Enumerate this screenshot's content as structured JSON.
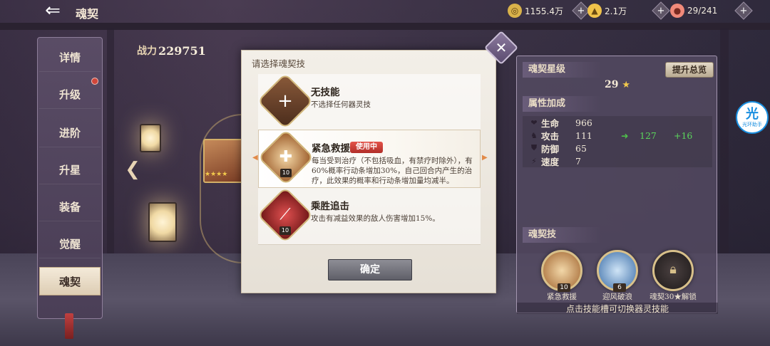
{
  "header": {
    "page_title": "魂契",
    "resources": [
      {
        "icon": "coin-icon",
        "value": "1155.4万",
        "color": "#d9b24a"
      },
      {
        "icon": "gold-ingot-icon",
        "value": "2.1万",
        "color": "#f0c24a"
      },
      {
        "icon": "peach-icon",
        "value": "29/241",
        "color": "#f08a7a"
      }
    ]
  },
  "nav": {
    "items": [
      {
        "label": "详情"
      },
      {
        "label": "升级"
      },
      {
        "label": "进阶"
      },
      {
        "label": "升星"
      },
      {
        "label": "装备"
      },
      {
        "label": "觉醒"
      },
      {
        "label": "魂契"
      }
    ],
    "active_index": 6
  },
  "hero": {
    "power_label": "战力",
    "power_value": "229751"
  },
  "right_panel": {
    "star_section_title": "魂契星级",
    "star_upgrade_button": "提升总览",
    "star_total": "29",
    "star_symbol": "★",
    "attr_section_title": "属性加成",
    "attrs": [
      {
        "icon": "heart-icon",
        "name": "生命",
        "value": "966",
        "new": "",
        "diff": ""
      },
      {
        "icon": "attack-icon",
        "name": "攻击",
        "value": "111",
        "new": "127",
        "diff": "+16"
      },
      {
        "icon": "shield-icon",
        "name": "防御",
        "value": "65",
        "new": "",
        "diff": ""
      },
      {
        "icon": "speed-icon",
        "name": "速度",
        "value": "7",
        "new": "",
        "diff": ""
      }
    ],
    "skill_section_title": "魂契技",
    "skills": [
      {
        "level": "10",
        "caption": "紧急救援"
      },
      {
        "level": "6",
        "caption": "迎风破浪"
      },
      {
        "level": "",
        "caption": "魂契30★解锁"
      }
    ],
    "hint": "点击技能槽可切换器灵技能"
  },
  "modal": {
    "title": "请选择魂契技",
    "options": [
      {
        "name": "无技能",
        "desc": "不选择任何器灵技",
        "level": "",
        "tag": ""
      },
      {
        "name": "紧急救援",
        "desc": "每当受到治疗（不包括吸血，有禁疗时除外），有60%概率行动条增加30%，自己回合内产生的治疗，此效果的概率和行动条增加量均减半。",
        "level": "10",
        "tag": "使用中"
      },
      {
        "name": "乘胜追击",
        "desc": "攻击有减益效果的敌人伤害增加15%。",
        "level": "10",
        "tag": ""
      }
    ],
    "selected_index": 1,
    "confirm_label": "确定"
  },
  "helper": {
    "glyph": "光",
    "label": "光环助手"
  }
}
